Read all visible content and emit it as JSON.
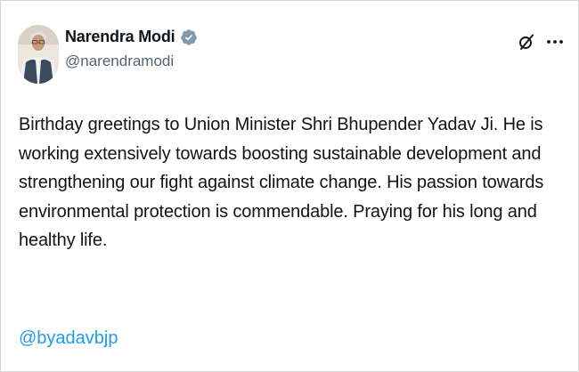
{
  "tweet": {
    "author": {
      "display_name": "Narendra Modi",
      "handle": "@narendramodi",
      "verified": true
    },
    "text": "Birthday greetings to Union Minister Shri Bhupender Yadav Ji. He is working extensively towards boosting sustainable development and strengthening our fight against climate change. His passion towards environmental protection is commendable. Praying for his long and healthy life.",
    "mention": "@byadavbjp"
  },
  "icons": {
    "verified": "verified-badge-icon",
    "grok": "grok-icon",
    "more": "more-options-icon"
  },
  "colors": {
    "text": "#0f1419",
    "secondary": "#536471",
    "link": "#1d9bf0",
    "verified_badge": "#829aab"
  }
}
